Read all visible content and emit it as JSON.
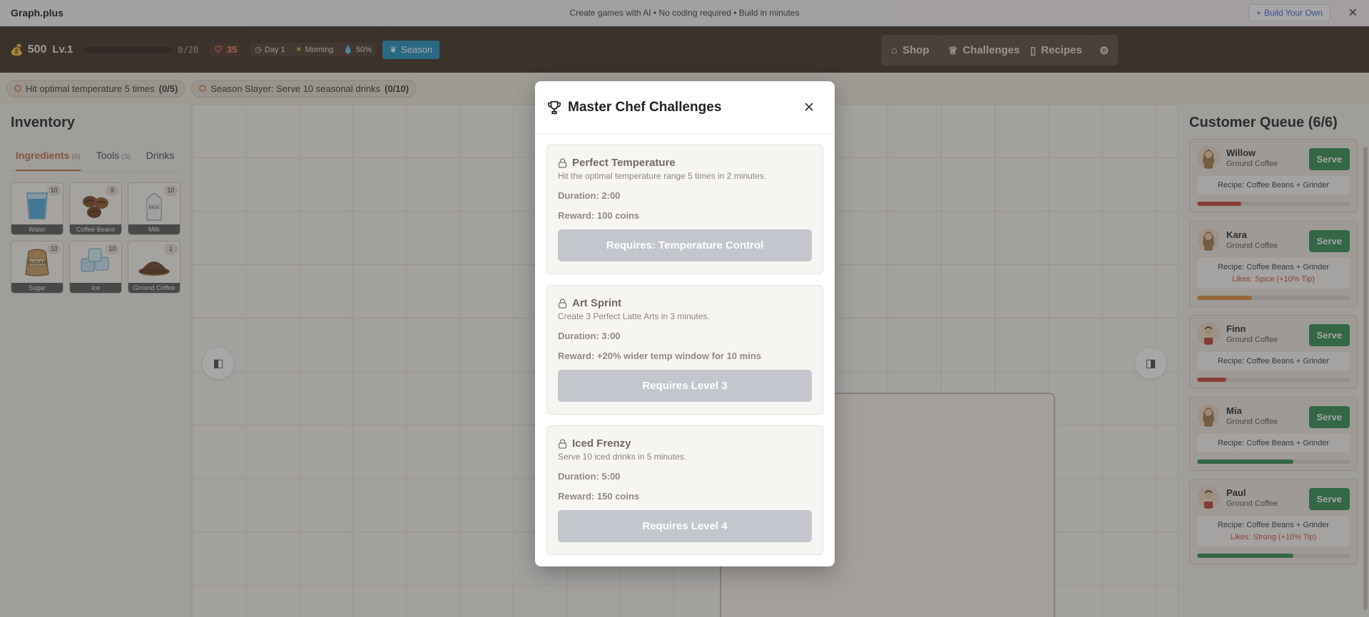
{
  "banner": {
    "brand": "Graph.plus",
    "message": "Create games with AI • No coding required • Build in minutes",
    "build_label": "Build Your Own"
  },
  "topbar": {
    "coins": "500",
    "level": "Lv.1",
    "xp": "0/20",
    "xp_progress": 0,
    "hearts": "35",
    "day": "Day 1",
    "time_of_day": "Morning",
    "humidity": "50%",
    "season_label": "Season",
    "nav": {
      "shop": "Shop",
      "challenges": "Challenges",
      "recipes": "Recipes"
    }
  },
  "goals": [
    {
      "text": "Hit optimal temperature 5 times",
      "progress": "(0/5)"
    },
    {
      "text": "Season Slayer: Serve 10 seasonal drinks",
      "progress": "(0/10)"
    }
  ],
  "inventory": {
    "title": "Inventory",
    "tabs": [
      {
        "label": "Ingredients",
        "count": "(6)"
      },
      {
        "label": "Tools",
        "count": "(3)"
      },
      {
        "label": "Drinks",
        "count": ""
      }
    ],
    "items": [
      {
        "name": "Water",
        "count": "10"
      },
      {
        "name": "Coffee Beans",
        "count": "9"
      },
      {
        "name": "Milk",
        "count": "10"
      },
      {
        "name": "Sugar",
        "count": "10"
      },
      {
        "name": "Ice",
        "count": "10"
      },
      {
        "name": "Ground Coffee",
        "count": "1"
      }
    ]
  },
  "queue": {
    "title": "Customer Queue (6/6)",
    "serve_label": "Serve",
    "recipe_prefix": "Recipe:",
    "customers": [
      {
        "name": "Willow",
        "drink": "Ground Coffee",
        "recipe": "Coffee Beans + Grinder",
        "likes": "",
        "patience": 0.29,
        "bar_color": "#c9413a"
      },
      {
        "name": "Kara",
        "drink": "Ground Coffee",
        "recipe": "Coffee Beans + Grinder",
        "likes": "Likes: Spice (+10% Tip)",
        "patience": 0.36,
        "bar_color": "#e08a3a"
      },
      {
        "name": "Finn",
        "drink": "Ground Coffee",
        "recipe": "Coffee Beans + Grinder",
        "likes": "",
        "patience": 0.19,
        "bar_color": "#c9413a"
      },
      {
        "name": "Mia",
        "drink": "Ground Coffee",
        "recipe": "Coffee Beans + Grinder",
        "likes": "",
        "patience": 0.63,
        "bar_color": "#2f8a4e"
      },
      {
        "name": "Paul",
        "drink": "Ground Coffee",
        "recipe": "Coffee Beans + Grinder",
        "likes": "Likes: Strong (+10% Tip)",
        "patience": 0.63,
        "bar_color": "#2f8a4e"
      }
    ]
  },
  "modal": {
    "title": "Master Chef Challenges",
    "challenges": [
      {
        "title": "Perfect Temperature",
        "desc": "Hit the optimal temperature range 5 times in 2 minutes.",
        "duration": "Duration: 2:00",
        "reward": "Reward: 100 coins",
        "button": "Requires: Temperature Control"
      },
      {
        "title": "Art Sprint",
        "desc": "Create 3 Perfect Latte Arts in 3 minutes.",
        "duration": "Duration: 3:00",
        "reward": "Reward: +20% wider temp window for 10 mins",
        "button": "Requires Level 3"
      },
      {
        "title": "Iced Frenzy",
        "desc": "Serve 10 iced drinks in 5 minutes.",
        "duration": "Duration: 5:00",
        "reward": "Reward: 150 coins",
        "button": "Requires Level 4"
      }
    ]
  },
  "colors": {
    "header_bg": "#3b2a1f",
    "accent": "#c26b3a",
    "season": "#1a8fc0",
    "serve": "#2f8a4e",
    "locked_button": "#c3c6cc"
  }
}
